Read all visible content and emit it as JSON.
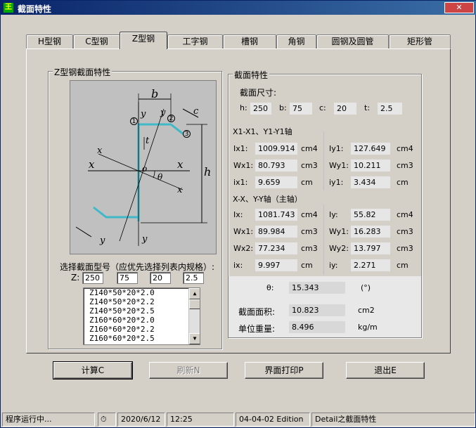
{
  "window": {
    "title": "截面特性"
  },
  "tabs": [
    {
      "label": "H型钢"
    },
    {
      "label": "C型钢"
    },
    {
      "label": "Z型钢"
    },
    {
      "label": "工字钢"
    },
    {
      "label": "槽钢"
    },
    {
      "label": "角钢"
    },
    {
      "label": "圆钢及圆管"
    },
    {
      "label": "矩形管"
    }
  ],
  "left_group": {
    "title": "Z型钢截面特性",
    "figure_labels": {
      "b": "b",
      "c": "c",
      "t": "t",
      "h": "h",
      "x": "x",
      "x1": "x",
      "y": "y",
      "y1": "y",
      "o": "o",
      "theta": "θ",
      "n1": "1",
      "n2": "2",
      "n3": "3"
    },
    "select_label": "选择截面型号（应优先选择列表内规格）:",
    "z_label": "Z:",
    "inputs": [
      "250",
      "75",
      "20",
      "2.5"
    ],
    "list_items": [
      "Z140*50*20*2.0",
      "Z140*50*20*2.2",
      "Z140*50*20*2.5",
      "Z160*60*20*2.0",
      "Z160*60*20*2.2",
      "Z160*60*20*2.5"
    ]
  },
  "right_group": {
    "title": "截面特性",
    "dims_title": "截面尺寸:",
    "dims": [
      {
        "label": "h:",
        "value": "250"
      },
      {
        "label": "b:",
        "value": "75"
      },
      {
        "label": "c:",
        "value": "20"
      },
      {
        "label": "t:",
        "value": "2.5"
      }
    ],
    "axis1_title": "X1-X1、Y1-Y1轴",
    "axis1_rows": [
      {
        "l1": "Ix1:",
        "v1": "1009.914",
        "u1": "cm4",
        "l2": "Iy1:",
        "v2": "127.649",
        "u2": "cm4"
      },
      {
        "l1": "Wx1:",
        "v1": "80.793",
        "u1": "cm3",
        "l2": "Wy1:",
        "v2": "10.211",
        "u2": "cm3"
      },
      {
        "l1": "ix1:",
        "v1": "9.659",
        "u1": "cm",
        "l2": "iy1:",
        "v2": "3.434",
        "u2": "cm"
      }
    ],
    "axis2_title": "X-X、Y-Y轴（主轴）",
    "axis2_rows": [
      {
        "l1": "Ix:",
        "v1": "1081.743",
        "u1": "cm4",
        "l2": "Iy:",
        "v2": "55.82",
        "u2": "cm4"
      },
      {
        "l1": "Wx1:",
        "v1": "89.984",
        "u1": "cm3",
        "l2": "Wy1:",
        "v2": "16.283",
        "u2": "cm3"
      },
      {
        "l1": "Wx2:",
        "v1": "77.234",
        "u1": "cm3",
        "l2": "Wy2:",
        "v2": "13.797",
        "u2": "cm3"
      },
      {
        "l1": "ix:",
        "v1": "9.997",
        "u1": "cm",
        "l2": "iy:",
        "v2": "2.271",
        "u2": "cm"
      }
    ],
    "theta": {
      "label": "θ:",
      "value": "15.343",
      "unit": "(°)"
    },
    "area": {
      "label": "截面面积:",
      "value": "10.823",
      "unit": "cm2"
    },
    "weight": {
      "label": "单位重量:",
      "value": "8.496",
      "unit": "kg/m"
    }
  },
  "buttons": {
    "calc": "计算C",
    "refresh": "刷新N",
    "print": "界面打印P",
    "exit": "退出E"
  },
  "status": {
    "running": "程序运行中...",
    "date": "2020/6/12",
    "time": "12:25",
    "edition": "04-04-02 Edition",
    "detail": "Detail之截面特性"
  },
  "colors": {
    "titlebar": "#0a246a",
    "section_line": "#3fb8c8"
  }
}
